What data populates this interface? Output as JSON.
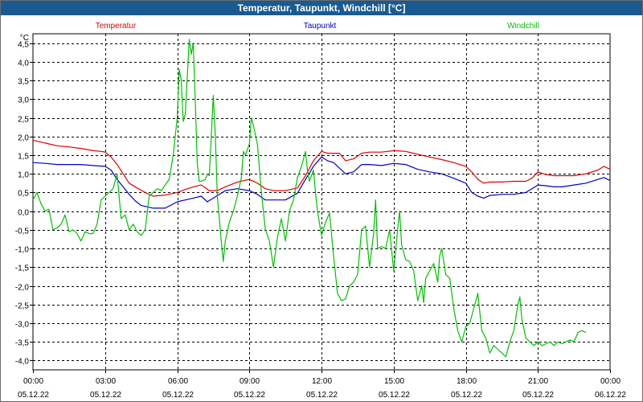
{
  "window": {
    "title": "Temperatur, Taupunkt, Windchill [°C]"
  },
  "chart_data": {
    "type": "line",
    "title": "Temperatur, Taupunkt, Windchill [°C]",
    "ylabel": "°C",
    "ylim": [
      -4.25,
      4.75
    ],
    "xlim": [
      "2022-12-05T00:00",
      "2022-12-06T00:00"
    ],
    "grid": true,
    "legend": "top",
    "x_ticks": [
      {
        "time": "00:00",
        "date": "05.12.22"
      },
      {
        "time": "03:00",
        "date": "05.12.22"
      },
      {
        "time": "06:00",
        "date": "05.12.22"
      },
      {
        "time": "09:00",
        "date": "05.12.22"
      },
      {
        "time": "12:00",
        "date": "05.12.22"
      },
      {
        "time": "15:00",
        "date": "05.12.22"
      },
      {
        "time": "18:00",
        "date": "05.12.22"
      },
      {
        "time": "21:00",
        "date": "05.12.22"
      },
      {
        "time": "00:00",
        "date": "06.12.22"
      }
    ],
    "y_ticks": [
      "4,5",
      "4,0",
      "3,5",
      "3,0",
      "2,5",
      "2,0",
      "1,5",
      "1,0",
      "0,5",
      "0,0",
      "-0,5",
      "-1,0",
      "-1,5",
      "-2,0",
      "-2,5",
      "-3,0",
      "-3,5",
      "-4,0"
    ],
    "y_tick_values": [
      4.5,
      4.0,
      3.5,
      3.0,
      2.5,
      2.0,
      1.5,
      1.0,
      0.5,
      0.0,
      -0.5,
      -1.0,
      -1.5,
      -2.0,
      -2.5,
      -3.0,
      -3.5,
      -4.0
    ],
    "series": [
      {
        "name": "Temperatur",
        "color": "#e00000",
        "points": [
          [
            "00:00",
            1.9
          ],
          [
            "00:20",
            1.85
          ],
          [
            "00:40",
            1.8
          ],
          [
            "01:00",
            1.75
          ],
          [
            "01:30",
            1.72
          ],
          [
            "02:00",
            1.68
          ],
          [
            "02:30",
            1.62
          ],
          [
            "02:50",
            1.6
          ],
          [
            "03:00",
            1.58
          ],
          [
            "03:15",
            1.45
          ],
          [
            "03:30",
            1.25
          ],
          [
            "03:45",
            1.0
          ],
          [
            "04:00",
            0.75
          ],
          [
            "04:20",
            0.62
          ],
          [
            "04:40",
            0.5
          ],
          [
            "05:00",
            0.4
          ],
          [
            "05:30",
            0.43
          ],
          [
            "06:00",
            0.5
          ],
          [
            "06:20",
            0.58
          ],
          [
            "06:40",
            0.65
          ],
          [
            "07:00",
            0.7
          ],
          [
            "07:20",
            0.55
          ],
          [
            "07:40",
            0.55
          ],
          [
            "08:00",
            0.65
          ],
          [
            "08:30",
            0.78
          ],
          [
            "09:00",
            0.85
          ],
          [
            "09:20",
            0.75
          ],
          [
            "09:40",
            0.6
          ],
          [
            "10:00",
            0.55
          ],
          [
            "10:30",
            0.55
          ],
          [
            "11:00",
            0.62
          ],
          [
            "11:20",
            0.95
          ],
          [
            "11:40",
            1.35
          ],
          [
            "12:00",
            1.6
          ],
          [
            "12:15",
            1.55
          ],
          [
            "12:30",
            1.55
          ],
          [
            "12:45",
            1.55
          ],
          [
            "13:00",
            1.35
          ],
          [
            "13:20",
            1.4
          ],
          [
            "13:40",
            1.55
          ],
          [
            "14:00",
            1.58
          ],
          [
            "14:30",
            1.58
          ],
          [
            "15:00",
            1.62
          ],
          [
            "15:30",
            1.6
          ],
          [
            "16:00",
            1.52
          ],
          [
            "16:30",
            1.45
          ],
          [
            "17:00",
            1.38
          ],
          [
            "17:30",
            1.3
          ],
          [
            "18:00",
            1.2
          ],
          [
            "18:15",
            1.05
          ],
          [
            "18:30",
            0.85
          ],
          [
            "18:45",
            0.75
          ],
          [
            "19:00",
            0.78
          ],
          [
            "19:30",
            0.78
          ],
          [
            "20:00",
            0.8
          ],
          [
            "20:30",
            0.8
          ],
          [
            "20:45",
            0.88
          ],
          [
            "21:00",
            1.05
          ],
          [
            "21:20",
            0.98
          ],
          [
            "21:40",
            0.95
          ],
          [
            "22:00",
            0.95
          ],
          [
            "22:30",
            0.95
          ],
          [
            "23:00",
            1.0
          ],
          [
            "23:30",
            1.1
          ],
          [
            "23:45",
            1.2
          ],
          [
            "24:00",
            1.12
          ]
        ]
      },
      {
        "name": "Taupunkt",
        "color": "#0000c8",
        "points": [
          [
            "00:00",
            1.3
          ],
          [
            "00:30",
            1.28
          ],
          [
            "01:00",
            1.25
          ],
          [
            "01:30",
            1.25
          ],
          [
            "02:00",
            1.25
          ],
          [
            "02:30",
            1.22
          ],
          [
            "03:00",
            1.2
          ],
          [
            "03:15",
            1.1
          ],
          [
            "03:30",
            0.85
          ],
          [
            "03:45",
            0.65
          ],
          [
            "04:00",
            0.45
          ],
          [
            "04:15",
            0.28
          ],
          [
            "04:30",
            0.15
          ],
          [
            "05:00",
            0.08
          ],
          [
            "05:30",
            0.08
          ],
          [
            "06:00",
            0.25
          ],
          [
            "06:20",
            0.3
          ],
          [
            "06:40",
            0.35
          ],
          [
            "07:00",
            0.4
          ],
          [
            "07:15",
            0.25
          ],
          [
            "07:30",
            0.35
          ],
          [
            "08:00",
            0.55
          ],
          [
            "08:30",
            0.6
          ],
          [
            "09:00",
            0.55
          ],
          [
            "09:20",
            0.45
          ],
          [
            "09:40",
            0.3
          ],
          [
            "10:00",
            0.3
          ],
          [
            "10:30",
            0.3
          ],
          [
            "11:00",
            0.48
          ],
          [
            "11:20",
            0.85
          ],
          [
            "11:40",
            1.2
          ],
          [
            "12:00",
            1.45
          ],
          [
            "12:15",
            1.35
          ],
          [
            "12:30",
            1.3
          ],
          [
            "12:45",
            1.15
          ],
          [
            "13:00",
            1.0
          ],
          [
            "13:20",
            1.05
          ],
          [
            "13:40",
            1.25
          ],
          [
            "14:00",
            1.25
          ],
          [
            "14:30",
            1.22
          ],
          [
            "15:00",
            1.28
          ],
          [
            "15:30",
            1.25
          ],
          [
            "16:00",
            1.12
          ],
          [
            "16:30",
            1.05
          ],
          [
            "17:00",
            1.0
          ],
          [
            "17:30",
            0.88
          ],
          [
            "18:00",
            0.75
          ],
          [
            "18:15",
            0.5
          ],
          [
            "18:30",
            0.4
          ],
          [
            "18:45",
            0.35
          ],
          [
            "19:00",
            0.42
          ],
          [
            "19:30",
            0.45
          ],
          [
            "20:00",
            0.45
          ],
          [
            "20:30",
            0.5
          ],
          [
            "21:00",
            0.7
          ],
          [
            "21:20",
            0.68
          ],
          [
            "21:40",
            0.65
          ],
          [
            "22:00",
            0.65
          ],
          [
            "22:30",
            0.7
          ],
          [
            "23:00",
            0.75
          ],
          [
            "23:30",
            0.85
          ],
          [
            "23:45",
            0.9
          ],
          [
            "24:00",
            0.82
          ]
        ]
      },
      {
        "name": "Windchill",
        "color": "#00c000",
        "points": [
          [
            "00:00",
            0.3
          ],
          [
            "00:10",
            0.5
          ],
          [
            "00:20",
            0.2
          ],
          [
            "00:30",
            0.0
          ],
          [
            "00:40",
            0.05
          ],
          [
            "00:50",
            -0.5
          ],
          [
            "01:00",
            -0.45
          ],
          [
            "01:10",
            -0.35
          ],
          [
            "01:20",
            -0.1
          ],
          [
            "01:30",
            -0.55
          ],
          [
            "01:40",
            -0.5
          ],
          [
            "01:50",
            -0.6
          ],
          [
            "02:00",
            -0.8
          ],
          [
            "02:10",
            -0.55
          ],
          [
            "02:20",
            -0.6
          ],
          [
            "02:30",
            -0.6
          ],
          [
            "02:40",
            -0.35
          ],
          [
            "02:50",
            0.3
          ],
          [
            "03:00",
            0.4
          ],
          [
            "03:10",
            0.5
          ],
          [
            "03:20",
            0.6
          ],
          [
            "03:30",
            1.0
          ],
          [
            "03:40",
            -0.2
          ],
          [
            "03:50",
            -0.1
          ],
          [
            "04:00",
            -0.5
          ],
          [
            "04:10",
            -0.35
          ],
          [
            "04:20",
            -0.55
          ],
          [
            "04:30",
            -0.65
          ],
          [
            "04:40",
            -0.5
          ],
          [
            "04:50",
            0.4
          ],
          [
            "05:00",
            0.5
          ],
          [
            "05:10",
            0.6
          ],
          [
            "05:20",
            0.55
          ],
          [
            "05:30",
            0.7
          ],
          [
            "05:40",
            0.85
          ],
          [
            "05:50",
            1.5
          ],
          [
            "06:00",
            2.5
          ],
          [
            "06:05",
            3.8
          ],
          [
            "06:10",
            3.5
          ],
          [
            "06:15",
            2.4
          ],
          [
            "06:20",
            2.6
          ],
          [
            "06:30",
            4.6
          ],
          [
            "06:35",
            4.2
          ],
          [
            "06:40",
            4.5
          ],
          [
            "06:45",
            3.0
          ],
          [
            "06:50",
            1.3
          ],
          [
            "06:55",
            0.8
          ],
          [
            "07:00",
            0.8
          ],
          [
            "07:10",
            0.85
          ],
          [
            "07:15",
            1.0
          ],
          [
            "07:20",
            0.95
          ],
          [
            "07:30",
            3.1
          ],
          [
            "07:35",
            2.0
          ],
          [
            "07:40",
            0.4
          ],
          [
            "07:50",
            -0.8
          ],
          [
            "07:55",
            -1.35
          ],
          [
            "08:00",
            -0.8
          ],
          [
            "08:10",
            -0.3
          ],
          [
            "08:20",
            0.0
          ],
          [
            "08:30",
            0.4
          ],
          [
            "08:40",
            0.9
          ],
          [
            "08:45",
            1.6
          ],
          [
            "08:50",
            1.5
          ],
          [
            "09:00",
            1.8
          ],
          [
            "09:05",
            2.5
          ],
          [
            "09:10",
            2.3
          ],
          [
            "09:20",
            1.8
          ],
          [
            "09:30",
            0.5
          ],
          [
            "09:40",
            -0.5
          ],
          [
            "09:50",
            -0.8
          ],
          [
            "10:00",
            -1.5
          ],
          [
            "10:10",
            -0.7
          ],
          [
            "10:20",
            -0.2
          ],
          [
            "10:25",
            -0.5
          ],
          [
            "10:30",
            -0.8
          ],
          [
            "10:40",
            0.0
          ],
          [
            "10:50",
            0.3
          ],
          [
            "11:00",
            0.9
          ],
          [
            "11:10",
            1.2
          ],
          [
            "11:20",
            1.6
          ],
          [
            "11:25",
            1.1
          ],
          [
            "11:30",
            0.8
          ],
          [
            "11:40",
            1.1
          ],
          [
            "11:45",
            0.5
          ],
          [
            "11:50",
            0.0
          ],
          [
            "12:00",
            -0.65
          ],
          [
            "12:10",
            -0.3
          ],
          [
            "12:20",
            -0.05
          ],
          [
            "12:30",
            -1.2
          ],
          [
            "12:40",
            -2.2
          ],
          [
            "12:50",
            -2.4
          ],
          [
            "13:00",
            -2.35
          ],
          [
            "13:10",
            -2.0
          ],
          [
            "13:20",
            -1.9
          ],
          [
            "13:30",
            -1.7
          ],
          [
            "13:40",
            -0.5
          ],
          [
            "13:50",
            -0.4
          ],
          [
            "14:00",
            -1.5
          ],
          [
            "14:10",
            -0.6
          ],
          [
            "14:15",
            0.3
          ],
          [
            "14:20",
            -1.0
          ],
          [
            "14:30",
            -0.95
          ],
          [
            "14:40",
            -1.0
          ],
          [
            "14:50",
            -0.5
          ],
          [
            "15:00",
            -1.6
          ],
          [
            "15:10",
            -0.5
          ],
          [
            "15:15",
            0.0
          ],
          [
            "15:20",
            -0.9
          ],
          [
            "15:30",
            -1.3
          ],
          [
            "15:40",
            -1.35
          ],
          [
            "15:50",
            -1.6
          ],
          [
            "16:00",
            -2.4
          ],
          [
            "16:10",
            -2.0
          ],
          [
            "16:15",
            -2.45
          ],
          [
            "16:20",
            -1.8
          ],
          [
            "16:30",
            -1.6
          ],
          [
            "16:40",
            -1.4
          ],
          [
            "16:50",
            -1.9
          ],
          [
            "16:55",
            -1.2
          ],
          [
            "17:00",
            -1.0
          ],
          [
            "17:10",
            -1.7
          ],
          [
            "17:20",
            -1.8
          ],
          [
            "17:30",
            -2.6
          ],
          [
            "17:40",
            -3.2
          ],
          [
            "17:50",
            -3.5
          ],
          [
            "18:00",
            -3.1
          ],
          [
            "18:10",
            -3.0
          ],
          [
            "18:20",
            -2.6
          ],
          [
            "18:30",
            -2.2
          ],
          [
            "18:40",
            -3.2
          ],
          [
            "18:50",
            -3.4
          ],
          [
            "19:00",
            -3.8
          ],
          [
            "19:10",
            -3.6
          ],
          [
            "19:20",
            -3.7
          ],
          [
            "19:30",
            -3.8
          ],
          [
            "19:40",
            -3.9
          ],
          [
            "19:50",
            -3.5
          ],
          [
            "20:00",
            -3.2
          ],
          [
            "20:10",
            -2.5
          ],
          [
            "20:15",
            -2.3
          ],
          [
            "20:20",
            -2.9
          ],
          [
            "20:30",
            -3.4
          ],
          [
            "20:40",
            -3.5
          ],
          [
            "20:50",
            -3.6
          ],
          [
            "21:00",
            -3.5
          ],
          [
            "21:10",
            -3.6
          ],
          [
            "21:20",
            -3.55
          ],
          [
            "21:30",
            -3.5
          ],
          [
            "21:40",
            -3.6
          ],
          [
            "21:50",
            -3.5
          ],
          [
            "22:00",
            -3.55
          ],
          [
            "22:10",
            -3.5
          ],
          [
            "22:20",
            -3.45
          ],
          [
            "22:30",
            -3.5
          ],
          [
            "22:40",
            -3.25
          ],
          [
            "22:50",
            -3.2
          ],
          [
            "23:00",
            -3.25
          ]
        ]
      }
    ]
  }
}
